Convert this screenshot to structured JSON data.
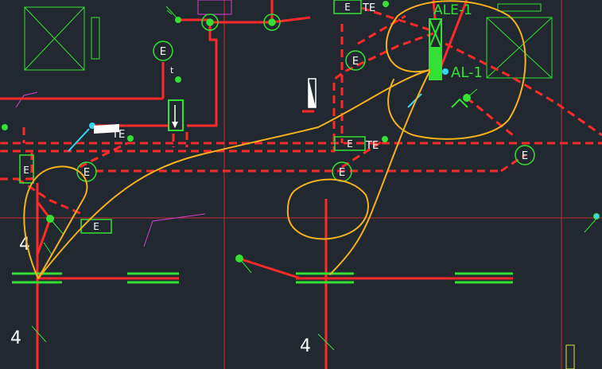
{
  "colors": {
    "background": "#212830",
    "pipe": "#ff2a2a",
    "device": "#35e035",
    "markup": "#f5b21c",
    "axis": "#c43030",
    "accent_magenta": "#d240d2",
    "accent_cyan": "#38d6f0",
    "white": "#ffffff"
  },
  "labels": {
    "exhaust_tag": "E",
    "temp_tag": "TE",
    "unit_ale": "ALE-1",
    "unit_al": "AL-1",
    "dim_4": "4",
    "small_t": "t"
  }
}
